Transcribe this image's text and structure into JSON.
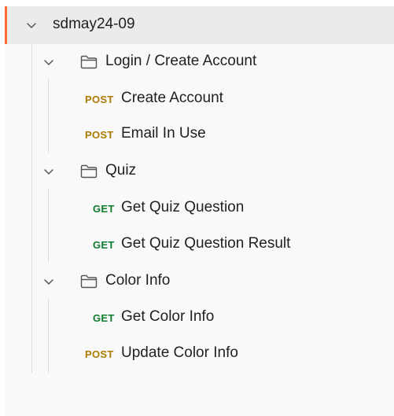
{
  "collection": {
    "name": "sdmay24-09",
    "expanded": true,
    "folders": [
      {
        "name": "Login / Create Account",
        "expanded": true,
        "requests": [
          {
            "method": "POST",
            "name": "Create Account"
          },
          {
            "method": "POST",
            "name": "Email In Use"
          }
        ]
      },
      {
        "name": "Quiz",
        "expanded": true,
        "requests": [
          {
            "method": "GET",
            "name": "Get Quiz Question"
          },
          {
            "method": "GET",
            "name": "Get Quiz Question Result"
          }
        ]
      },
      {
        "name": "Color Info",
        "expanded": true,
        "requests": [
          {
            "method": "GET",
            "name": "Get Color Info"
          },
          {
            "method": "POST",
            "name": "Update Color Info"
          }
        ]
      }
    ]
  },
  "colors": {
    "accent": "#ff6c37",
    "post": "#ad7a03",
    "get": "#0f7b2d",
    "selected_row": "#ebebeb",
    "sidebar_bg": "#f9f9f9"
  },
  "icons": {
    "chevron": "chevron-down-icon",
    "folder": "folder-icon"
  }
}
